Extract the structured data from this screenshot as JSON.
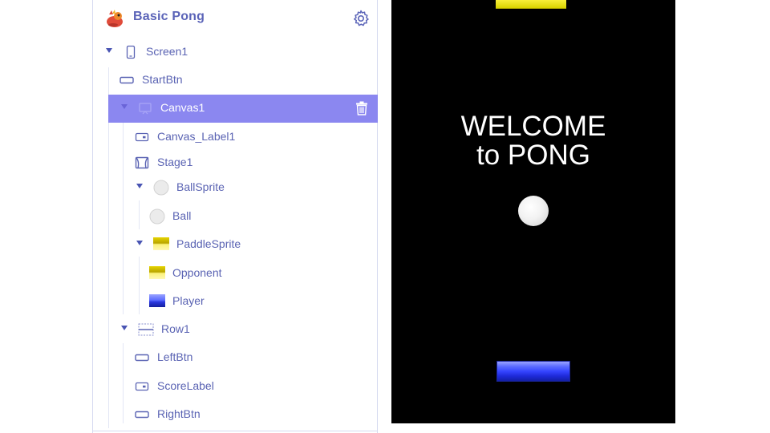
{
  "app": {
    "title": "Basic Pong"
  },
  "tree": {
    "items": [
      {
        "label": "Screen1",
        "icon": "phone-icon"
      },
      {
        "label": "StartBtn",
        "icon": "button-icon"
      },
      {
        "label": "Canvas1",
        "icon": "canvas-icon",
        "selected": true
      },
      {
        "label": "Canvas_Label1",
        "icon": "label-icon"
      },
      {
        "label": "Stage1",
        "icon": "stage-icon"
      },
      {
        "label": "BallSprite",
        "icon": "ball-icon"
      },
      {
        "label": "Ball",
        "icon": "ball-icon"
      },
      {
        "label": "PaddleSprite",
        "icon": "yellow-paddle-icon"
      },
      {
        "label": "Opponent",
        "icon": "yellow-paddle-icon"
      },
      {
        "label": "Player",
        "icon": "blue-paddle-icon"
      },
      {
        "label": "Row1",
        "icon": "row-icon"
      },
      {
        "label": "LeftBtn",
        "icon": "button-icon"
      },
      {
        "label": "ScoreLabel",
        "icon": "label-icon"
      },
      {
        "label": "RightBtn",
        "icon": "button-icon"
      }
    ]
  },
  "game": {
    "welcome_line1": "WELCOME",
    "welcome_line2": "to PONG"
  },
  "colors": {
    "accent": "#5b64b8",
    "selected_bg": "#8b87f0",
    "canvas_bg": "#000000"
  }
}
